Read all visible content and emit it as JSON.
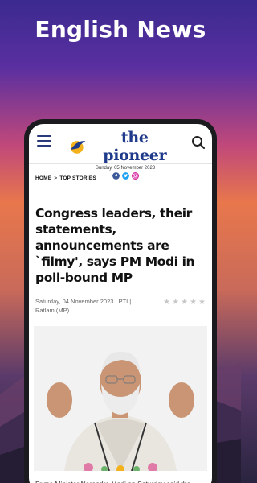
{
  "promo": {
    "title": "English News"
  },
  "header": {
    "logo_text": "the pioneer",
    "date": "Sunday, 05 November 2023",
    "social": [
      {
        "icon": "facebook-icon",
        "color": "#3b5998"
      },
      {
        "icon": "twitter-icon",
        "color": "#1da1f2"
      },
      {
        "icon": "instagram-icon",
        "color": "#d6249f"
      }
    ]
  },
  "breadcrumb": {
    "home": "HOME",
    "separator": ">",
    "section": "TOP STORIES"
  },
  "article": {
    "headline": "Congress leaders, their statements, announcements are `filmy', says PM Modi in poll-bound MP",
    "meta": "Saturday, 04 November 2023 | PTI | Ratlam (MP)",
    "rating": {
      "value": 0,
      "max": 5
    },
    "caption": "Prime Minister Narendra Modi on Saturday said the Congress leaders, their \"dialogues\" and their"
  },
  "colors": {
    "brand": "#1f3a8a",
    "accent": "#f3b21b"
  }
}
